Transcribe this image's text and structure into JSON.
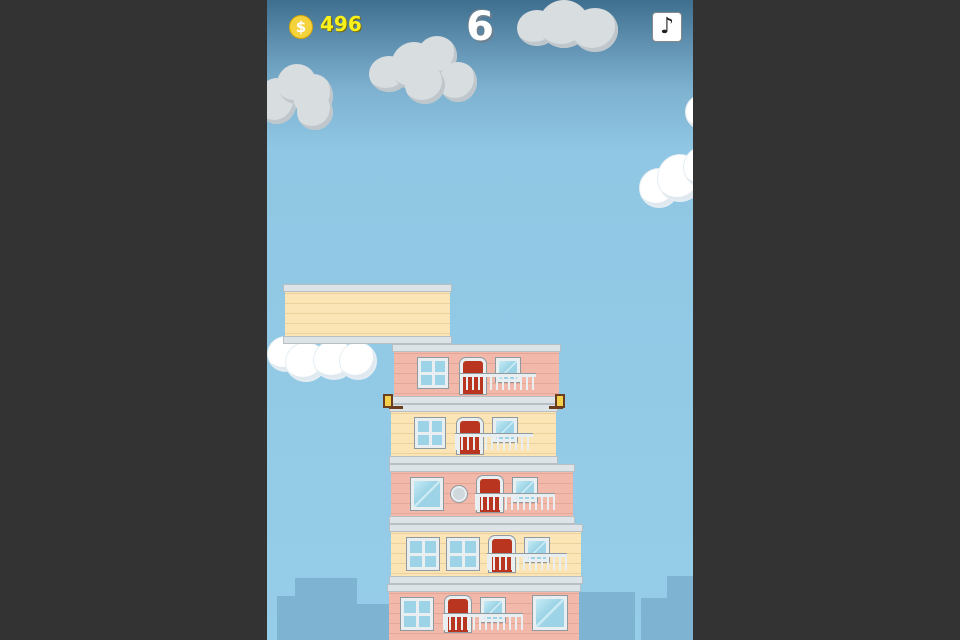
{
  "hud": {
    "coin_icon": "dollar-coin-icon",
    "coin_symbol": "$",
    "coins": "496",
    "score": "6",
    "music_icon": "music-note-icon",
    "music_symbol": "♪"
  },
  "colors": {
    "background": "#333333",
    "sky": "#96cde8",
    "coin_text": "#f9f11a",
    "brick_pink": "#f2b9aa",
    "brick_cream": "#fbe4b5",
    "door": "#b9351f"
  },
  "tower": {
    "floor_count": 5,
    "floors": [
      {
        "style": "pink"
      },
      {
        "style": "cream"
      },
      {
        "style": "pink"
      },
      {
        "style": "cream"
      },
      {
        "style": "pink"
      }
    ],
    "swinging_block": {
      "style": "cream"
    }
  }
}
